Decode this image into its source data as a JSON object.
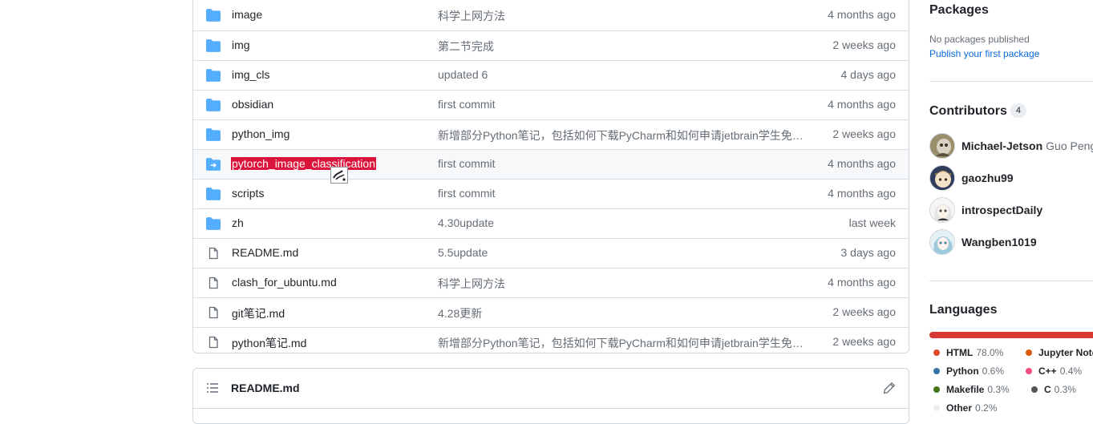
{
  "files": [
    {
      "name": "image",
      "type": "folder",
      "message": "科学上网方法",
      "age": "4 months ago"
    },
    {
      "name": "img",
      "type": "folder",
      "message": "第二节完成",
      "age": "2 weeks ago"
    },
    {
      "name": "img_cls",
      "type": "folder",
      "message": "updated 6",
      "age": "4 days ago"
    },
    {
      "name": "obsidian",
      "type": "folder",
      "message": "first commit",
      "age": "4 months ago"
    },
    {
      "name": "python_img",
      "type": "folder",
      "message": "新增部分Python笔记，包括如何下载PyCharm和如何申请jetbrain学生免…",
      "age": "2 weeks ago"
    },
    {
      "name": "pytorch_image_classification",
      "type": "submodule",
      "message": "first commit",
      "age": "4 months ago"
    },
    {
      "name": "scripts",
      "type": "folder",
      "message": "first commit",
      "age": "4 months ago"
    },
    {
      "name": "zh",
      "type": "folder",
      "message": "4.30update",
      "age": "last week"
    },
    {
      "name": "README.md",
      "type": "file",
      "message": "5.5update",
      "age": "3 days ago"
    },
    {
      "name": "clash_for_ubuntu.md",
      "type": "file",
      "message": "科学上网方法",
      "age": "4 months ago"
    },
    {
      "name": "git笔记.md",
      "type": "file",
      "message": "4.28更新",
      "age": "2 weeks ago"
    },
    {
      "name": "python笔记.md",
      "type": "file",
      "message": "新增部分Python笔记，包括如何下载PyCharm和如何申请jetbrain学生免…",
      "age": "2 weeks ago"
    }
  ],
  "readme": {
    "title": "README.md",
    "list_icon": "list-icon",
    "edit_icon": "pencil-icon"
  },
  "sidebar": {
    "packages": {
      "title": "Packages",
      "none_text": "No packages published",
      "publish_link": "Publish your first package"
    },
    "contributors": {
      "title": "Contributors",
      "count": "4",
      "people": [
        {
          "login": "Michael-Jetson",
          "name": "Guo Peng"
        },
        {
          "login": "gaozhu99",
          "name": ""
        },
        {
          "login": "introspectDaily",
          "name": ""
        },
        {
          "login": "Wangben1019",
          "name": ""
        }
      ]
    },
    "languages": {
      "title": "Languages",
      "items": [
        {
          "name": "HTML",
          "percent": "78.0%",
          "color": "#e34c26"
        },
        {
          "name": "Jupyter Notebook",
          "percent": "",
          "color": "#da5b0b"
        },
        {
          "name": "Python",
          "percent": "0.6%",
          "color": "#3572A5"
        },
        {
          "name": "C++",
          "percent": "0.4%",
          "color": "#f34b7d"
        },
        {
          "name": "Makefile",
          "percent": "0.3%",
          "color": "#427819"
        },
        {
          "name": "C",
          "percent": "0.3%",
          "color": "#555555"
        },
        {
          "name": "Other",
          "percent": "0.2%",
          "color": "#ededed"
        }
      ]
    }
  },
  "colors": {
    "folder": "#54aeff",
    "file_icon": "#656d76",
    "selection": "#dc143c",
    "link": "#0969da"
  }
}
